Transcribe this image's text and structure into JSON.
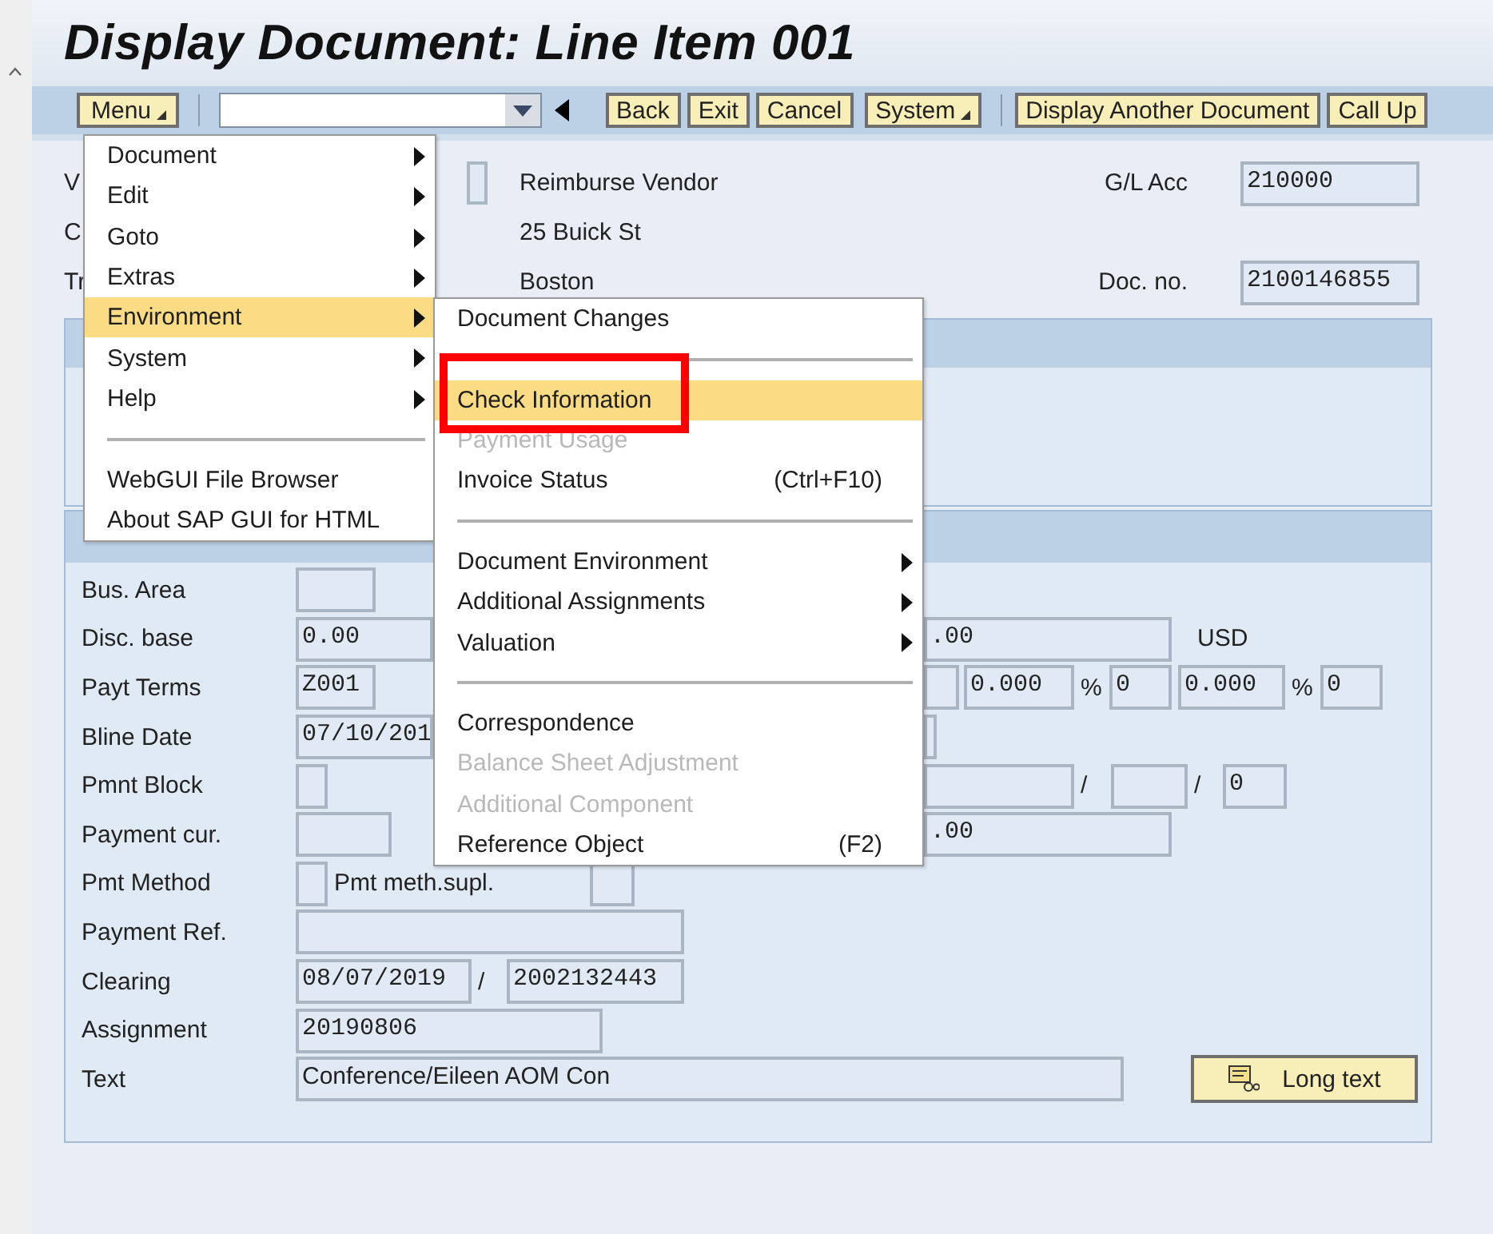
{
  "title": "Display Document: Line Item 001",
  "toolbar": {
    "menu_button": {
      "label": "Menu"
    },
    "nav_buttons": [
      {
        "label": "Back",
        "kind": "plain"
      },
      {
        "label": "Exit",
        "kind": "plain"
      },
      {
        "label": "Cancel",
        "kind": "plain"
      },
      {
        "label": "System",
        "kind": "dropdown"
      }
    ],
    "app_buttons": [
      {
        "label": "Display Another Document"
      },
      {
        "label": "Call Up"
      }
    ]
  },
  "header": {
    "rows": [
      {
        "label": "V",
        "address": "Reimburse Vendor",
        "field_label": "G/L Acc",
        "field_value": "210000"
      },
      {
        "label": "C",
        "address": "25 Buick St"
      },
      {
        "label": "Tr",
        "address": "Boston",
        "field_label": "Doc. no.",
        "field_value": "2100146855"
      }
    ]
  },
  "payment_panel": {
    "rows": [
      {
        "label": "Bus. Area",
        "cells": [
          {
            "kind": "field"
          }
        ]
      },
      {
        "label": "Disc. base",
        "cells": [
          {
            "kind": "field",
            "value": "0.00"
          },
          {
            "kind": "field",
            "value": ".00"
          }
        ],
        "currency": "USD"
      },
      {
        "label": "Payt Terms",
        "cells": [
          {
            "kind": "field",
            "value": "Z001"
          },
          {
            "kind": "field"
          }
        ],
        "discounts": [
          {
            "percent": "0.000",
            "unit": "%",
            "days": "0"
          },
          {
            "percent": "0.000",
            "unit": "%",
            "days": "0"
          }
        ]
      },
      {
        "label": "Bline Date",
        "cells": [
          {
            "kind": "field",
            "value": "07/10/201"
          },
          {
            "kind": "field"
          }
        ]
      },
      {
        "label": "Pmnt Block",
        "cells": [
          {
            "kind": "field"
          },
          {
            "kind": "field",
            "suffix": "/"
          },
          {
            "kind": "field",
            "suffix": "/"
          },
          {
            "kind": "field",
            "value": "0"
          }
        ]
      },
      {
        "label": "Payment cur.",
        "cells": [
          {
            "kind": "field"
          },
          {
            "kind": "field",
            "value": ".00"
          }
        ]
      },
      {
        "label": "Pmt Method",
        "cells": [
          {
            "kind": "field"
          }
        ],
        "sub_field": {
          "label": "Pmt meth.supl."
        }
      },
      {
        "label": "Payment Ref.",
        "cells": [
          {
            "kind": "field"
          }
        ]
      },
      {
        "label": "Clearing",
        "cells": [
          {
            "kind": "field",
            "value": "08/07/2019",
            "suffix": "/"
          },
          {
            "kind": "field",
            "value": "2002132443"
          }
        ]
      },
      {
        "label": "Assignment",
        "cells": [
          {
            "kind": "field",
            "value": "20190806"
          }
        ]
      },
      {
        "label": "Text",
        "cells": [
          {
            "kind": "field",
            "value": "Conference/Eileen AOM Con"
          },
          {
            "kind": "button",
            "label": "Long text"
          }
        ]
      }
    ]
  },
  "main_menu": [
    {
      "kind": "item",
      "label": "Document",
      "submenu": true,
      "selected": false
    },
    {
      "kind": "item",
      "label": "Edit",
      "submenu": true,
      "selected": false
    },
    {
      "kind": "item",
      "label": "Goto",
      "submenu": true,
      "selected": false
    },
    {
      "kind": "item",
      "label": "Extras",
      "submenu": true,
      "selected": false
    },
    {
      "kind": "item",
      "label": "Environment",
      "submenu": true,
      "selected": true
    },
    {
      "kind": "item",
      "label": "System",
      "submenu": true,
      "selected": false
    },
    {
      "kind": "item",
      "label": "Help",
      "submenu": true,
      "selected": false
    },
    {
      "kind": "separator"
    },
    {
      "kind": "item",
      "label": "WebGUI File Browser",
      "submenu": false,
      "selected": false
    },
    {
      "kind": "item",
      "label": "About SAP GUI for HTML",
      "submenu": false,
      "selected": false
    }
  ],
  "environment_menu": [
    {
      "kind": "item",
      "label": "Document Changes",
      "submenu": false,
      "disabled": false,
      "selected": false
    },
    {
      "kind": "separator"
    },
    {
      "kind": "item",
      "label": "Check Information",
      "submenu": false,
      "disabled": false,
      "selected": true
    },
    {
      "kind": "item",
      "label": "Payment Usage",
      "submenu": false,
      "disabled": true,
      "selected": false
    },
    {
      "kind": "item",
      "label": "Invoice Status",
      "shortcut": "(Ctrl+F10)",
      "submenu": false,
      "disabled": false,
      "selected": false
    },
    {
      "kind": "separator"
    },
    {
      "kind": "item",
      "label": "Document Environment",
      "submenu": true,
      "disabled": false,
      "selected": false
    },
    {
      "kind": "item",
      "label": "Additional Assignments",
      "submenu": true,
      "disabled": false,
      "selected": false
    },
    {
      "kind": "item",
      "label": "Valuation",
      "submenu": true,
      "disabled": false,
      "selected": false
    },
    {
      "kind": "separator"
    },
    {
      "kind": "item",
      "label": "Correspondence",
      "submenu": false,
      "disabled": false,
      "selected": false
    },
    {
      "kind": "item",
      "label": "Balance Sheet Adjustment",
      "submenu": false,
      "disabled": true,
      "selected": false
    },
    {
      "kind": "item",
      "label": "Additional Component",
      "submenu": false,
      "disabled": true,
      "selected": false
    },
    {
      "kind": "item",
      "label": "Reference Object",
      "shortcut": "(F2)",
      "submenu": false,
      "disabled": false,
      "selected": false
    }
  ]
}
